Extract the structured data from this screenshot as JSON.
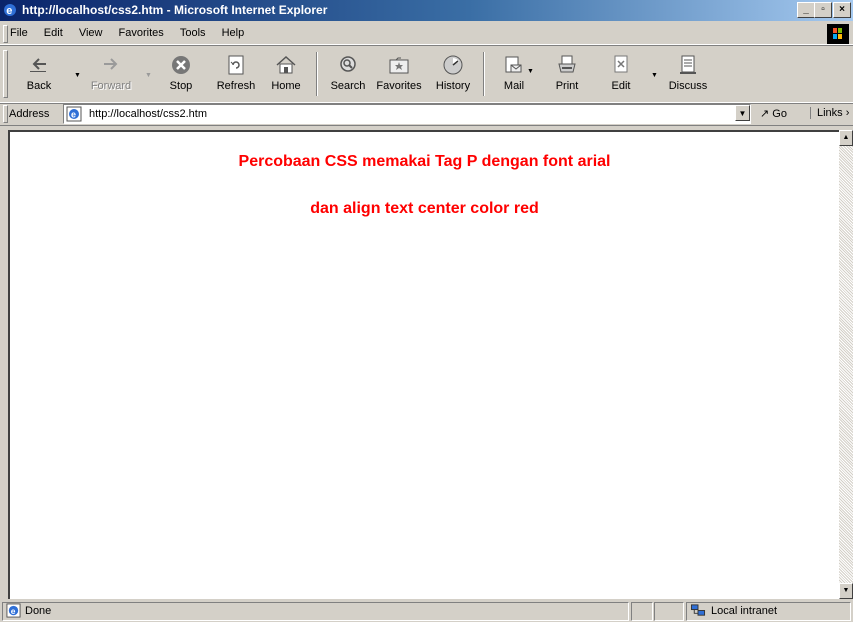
{
  "window": {
    "title": "http://localhost/css2.htm - Microsoft Internet Explorer",
    "controls": {
      "minimize": "_",
      "maximize": "▫",
      "close": "×"
    }
  },
  "menu": {
    "items": [
      {
        "label": "File"
      },
      {
        "label": "Edit"
      },
      {
        "label": "View"
      },
      {
        "label": "Favorites"
      },
      {
        "label": "Tools"
      },
      {
        "label": "Help"
      }
    ]
  },
  "toolbar": {
    "buttons": [
      {
        "label": "Back",
        "icon": "back-arrow-icon"
      },
      {
        "label": "Forward",
        "icon": "forward-arrow-icon",
        "disabled": true
      },
      {
        "label": "Stop",
        "icon": "stop-icon"
      },
      {
        "label": "Refresh",
        "icon": "refresh-icon"
      },
      {
        "label": "Home",
        "icon": "home-icon"
      },
      {
        "label": "Search",
        "icon": "search-icon"
      },
      {
        "label": "Favorites",
        "icon": "favorites-icon"
      },
      {
        "label": "History",
        "icon": "history-icon"
      },
      {
        "label": "Mail",
        "icon": "mail-icon"
      },
      {
        "label": "Print",
        "icon": "print-icon"
      },
      {
        "label": "Edit",
        "icon": "edit-icon"
      },
      {
        "label": "Discuss",
        "icon": "discuss-icon"
      }
    ]
  },
  "address": {
    "label": "Address",
    "url": "http://localhost/css2.htm",
    "go_label": "Go",
    "links_label": "Links"
  },
  "page": {
    "lines": [
      "Percobaan CSS memakai Tag P dengan font arial",
      "dan align text center color red"
    ],
    "text_color": "#ff0000"
  },
  "status": {
    "text": "Done",
    "zone": "Local intranet"
  }
}
